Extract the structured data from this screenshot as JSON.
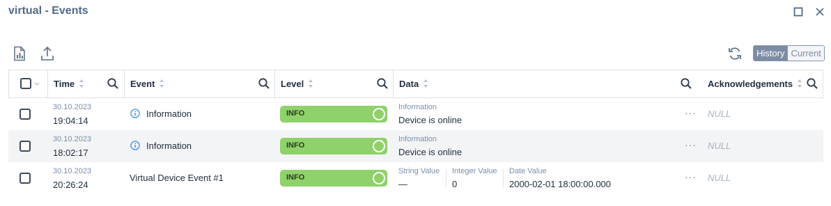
{
  "window": {
    "title": "virtual - Events"
  },
  "toolbar": {
    "history_label": "History",
    "current_label": "Current"
  },
  "columns": {
    "time": "Time",
    "event": "Event",
    "level": "Level",
    "data": "Data",
    "acknowledgements": "Acknowledgements"
  },
  "rows": [
    {
      "date": "30.10.2023",
      "time": "19:04:14",
      "event": "Information",
      "level": "INFO",
      "data_label": "Information",
      "data_value": "Device is online",
      "ack": "NULL"
    },
    {
      "date": "30.10.2023",
      "time": "18:02:17",
      "event": "Information",
      "level": "INFO",
      "data_label": "Information",
      "data_value": "Device is online",
      "ack": "NULL"
    },
    {
      "date": "30.10.2023",
      "time": "20:26:24",
      "event": "Virtual Device Event #1",
      "level": "INFO",
      "fields": [
        {
          "label": "String Value",
          "value": "—"
        },
        {
          "label": "Integer Value",
          "value": "0"
        },
        {
          "label": "Date Value",
          "value": "2000-02-01 18:00:00.000"
        }
      ],
      "ack": "NULL"
    }
  ],
  "icons": {
    "report": "report-icon",
    "export": "export-icon",
    "refresh": "refresh-icon",
    "maximize": "maximize-icon",
    "close": "close-icon",
    "search": "search-icon",
    "info": "info-icon"
  },
  "colors": {
    "title": "#4f6a88",
    "level_info": "#8fd16b",
    "segment_active": "#7b8ca3"
  }
}
